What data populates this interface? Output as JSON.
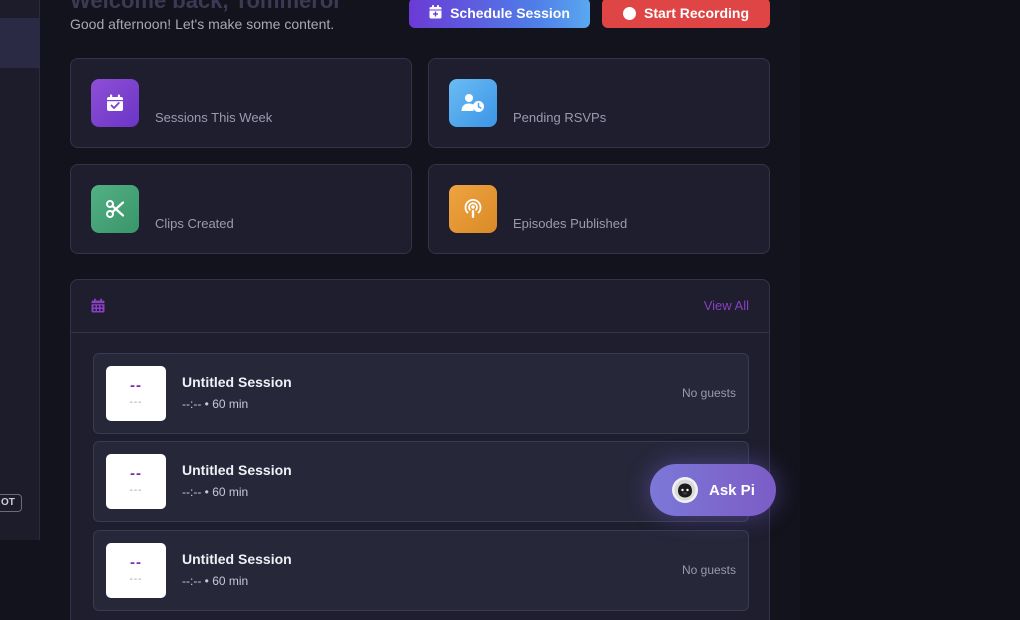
{
  "header": {
    "title": "Welcome back, Tommeror",
    "subtitle": "Good afternoon! Let's make some content.",
    "schedule_label": "Schedule Session",
    "record_label": "Start Recording"
  },
  "sidebar": {
    "badge": "OT"
  },
  "stats": [
    {
      "label": "Sessions This Week",
      "icon": "calendar-check-icon",
      "color": "#7b3fd0"
    },
    {
      "label": "Pending RSVPs",
      "icon": "user-clock-icon",
      "color": "#4aa6ee"
    },
    {
      "label": "Clips Created",
      "icon": "scissors-icon",
      "color": "#45a377"
    },
    {
      "label": "Episodes Published",
      "icon": "podcast-icon",
      "color": "#e6982f"
    }
  ],
  "sessions_panel": {
    "view_all_label": "View All",
    "sessions": [
      {
        "day": "--",
        "month": "---",
        "title": "Untitled Session",
        "meta": "--:-- • 60 min",
        "guests": "No guests"
      },
      {
        "day": "--",
        "month": "---",
        "title": "Untitled Session",
        "meta": "--:-- • 60 min",
        "guests": ""
      },
      {
        "day": "--",
        "month": "---",
        "title": "Untitled Session",
        "meta": "--:-- • 60 min",
        "guests": "No guests"
      }
    ]
  },
  "assistant": {
    "label": "Ask Pi"
  }
}
